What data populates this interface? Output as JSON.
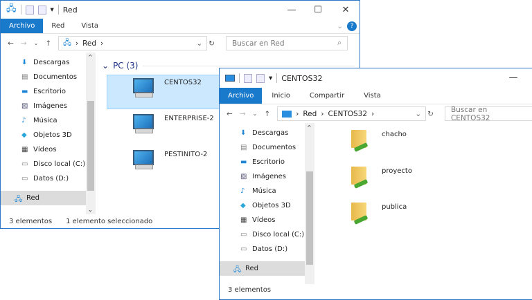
{
  "window1": {
    "title": "Red",
    "tabs": [
      "Archivo",
      "Red",
      "Vista"
    ],
    "breadcrumb": [
      "Red"
    ],
    "search_placeholder": "Buscar en Red",
    "nav": [
      "Descargas",
      "Documentos",
      "Escritorio",
      "Imágenes",
      "Música",
      "Objetos 3D",
      "Vídeos",
      "Disco local (C:)",
      "Datos (D:)",
      "Red"
    ],
    "group_header": "PC (3)",
    "items": [
      "CENTOS32",
      "ENTERPRISE-2",
      "PESTINITO-2"
    ],
    "selected_item": "CENTOS32",
    "status_count": "3 elementos",
    "status_selection": "1 elemento seleccionado"
  },
  "window2": {
    "title": "CENTOS32",
    "tabs": [
      "Archivo",
      "Inicio",
      "Compartir",
      "Vista"
    ],
    "breadcrumb": [
      "Red",
      "CENTOS32"
    ],
    "search_placeholder": "Buscar en CENTOS32",
    "nav": [
      "Descargas",
      "Documentos",
      "Escritorio",
      "Imágenes",
      "Música",
      "Objetos 3D",
      "Vídeos",
      "Disco local (C:)",
      "Datos (D:)",
      "Red"
    ],
    "items": [
      "chacho",
      "proyecto",
      "publica"
    ],
    "status_count": "3 elementos"
  },
  "colors": {
    "accent": "#1979ca",
    "selection": "#cce8ff",
    "nav_selected": "#dcdcdc"
  }
}
